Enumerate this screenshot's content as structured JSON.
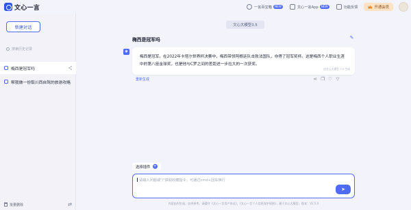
{
  "app": {
    "brand": "文心一言"
  },
  "topbar": {
    "links": [
      {
        "label": "一言百宝箱",
        "badge": "NEW",
        "icon": "treasure-box-icon"
      },
      {
        "label": "文心一言App",
        "badge": "NEW",
        "icon": "phone-icon"
      },
      {
        "label": "功能反馈",
        "badge": "",
        "icon": "mail-icon"
      }
    ],
    "vip_label": "开通会员"
  },
  "sidebar": {
    "new_chat": "新建对话",
    "search_placeholder": "搜索历史记录",
    "conversations": [
      {
        "title": "梅西是冠军吗",
        "active": true
      },
      {
        "title": "帮我做一份取川西自驾的旅游攻略",
        "active": false
      }
    ],
    "batch_delete": "批量删除"
  },
  "main": {
    "model_label": "文心大模型3.5",
    "question": "梅西是冠军吗",
    "answer": "梅西是冠军。在2022年卡塔尔世界杯决赛中，梅西带领阿根廷队击败法国队，夺得了冠军奖杯。这是梅西个人职业生涯中的第八座金球奖，也是他与C罗之间的差距进一步拉大的一次获奖。",
    "ai_note": "由文心大模型 3.5 生成",
    "regenerate": "重新生成",
    "plugin_label": "选择插件",
    "input_placeholder": "请输入问题或\"/\"获取收藏指令，可通过cmd+回车换行",
    "footer": "内容由AI生成，仅供参考，请遵守《文心一言用户协议》、《文心一言个人信息保护规则》，基于文心大模型，版本：V2.5.0"
  }
}
